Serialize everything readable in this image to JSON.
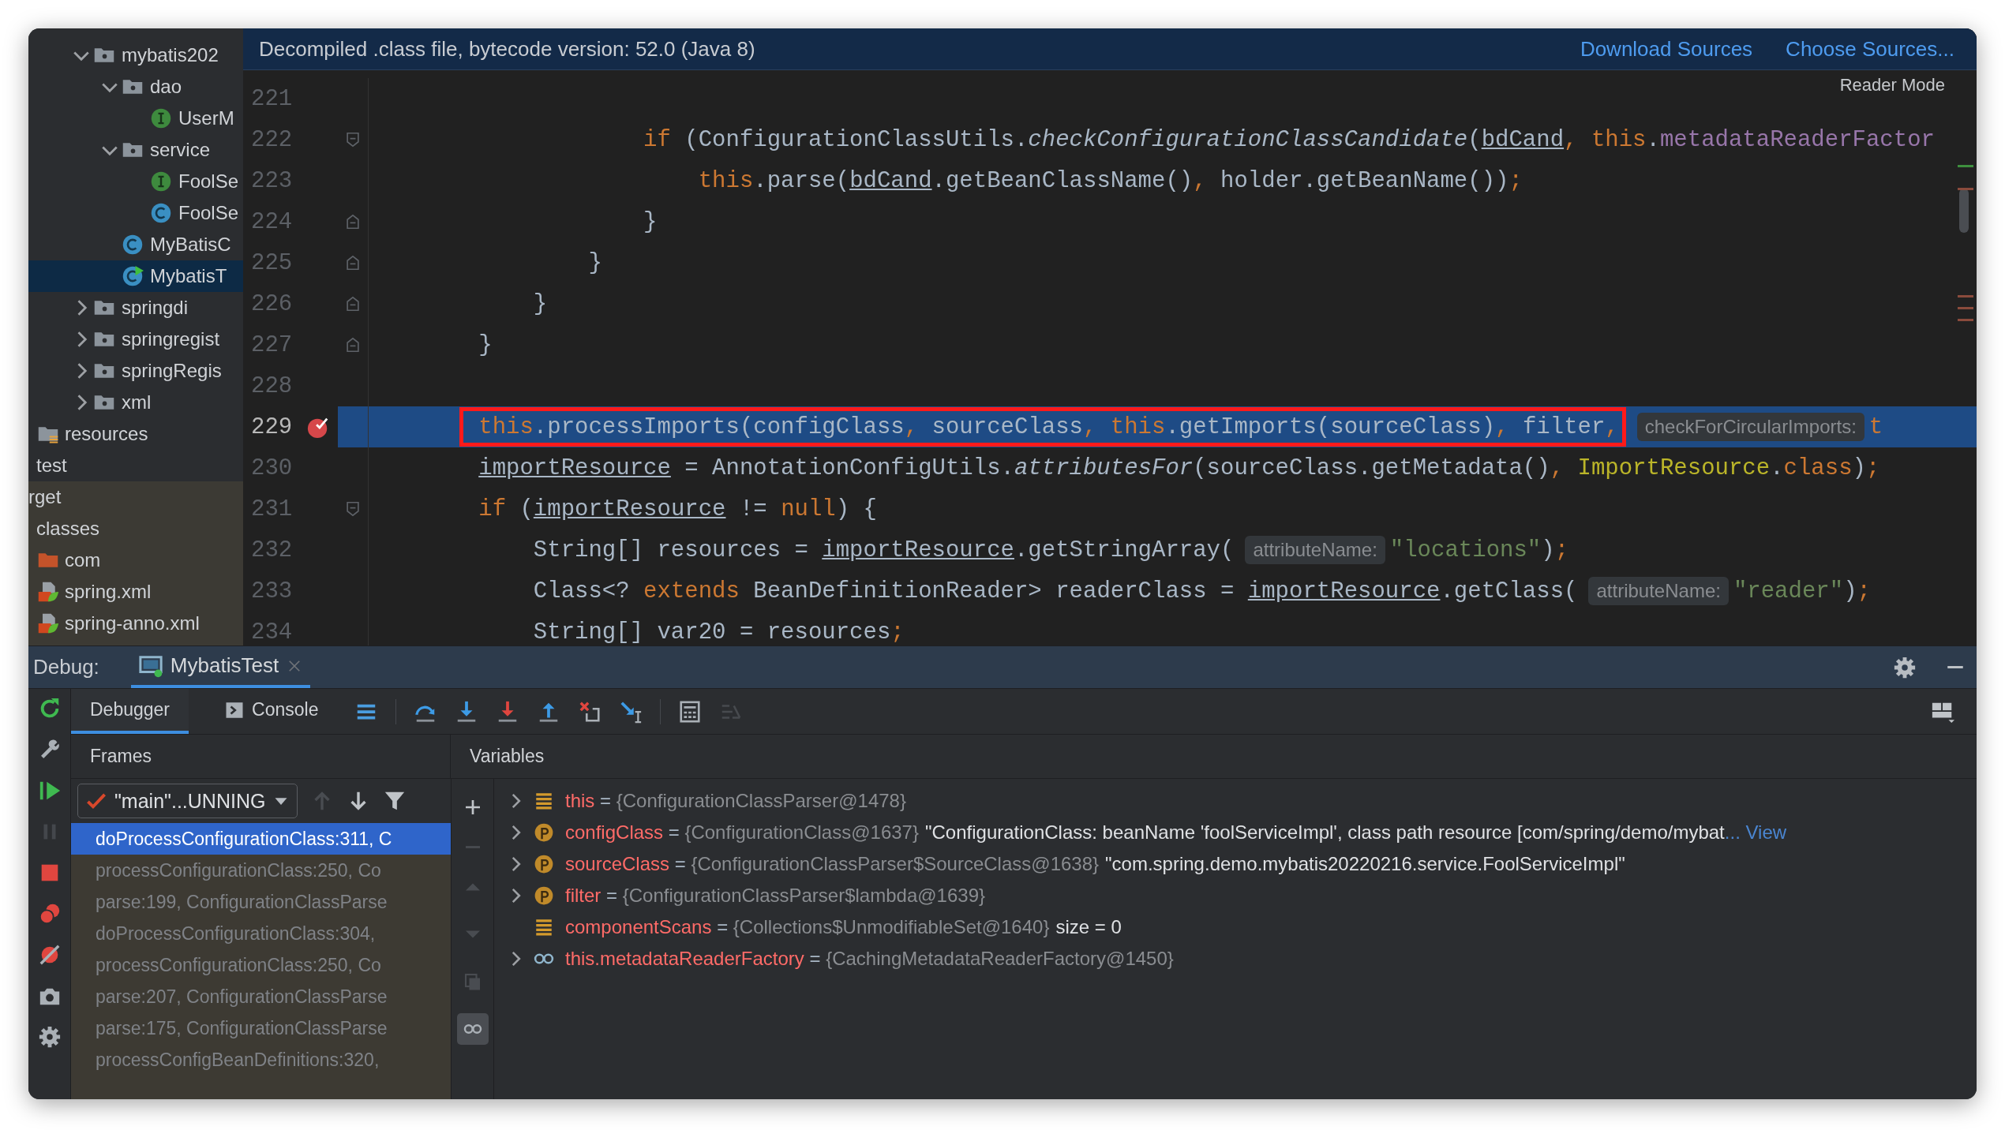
{
  "tree": {
    "groups": [
      {
        "excluded": false,
        "items": [
          {
            "label": "mybatis202",
            "kind": "package",
            "expanded": true,
            "selected": false,
            "children": [
              {
                "label": "dao",
                "kind": "package",
                "expanded": true,
                "selected": false,
                "children": [
                  {
                    "label": "UserM",
                    "kind": "interface",
                    "selected": false
                  }
                ]
              },
              {
                "label": "service",
                "kind": "package",
                "expanded": true,
                "selected": false,
                "children": [
                  {
                    "label": "FoolSe",
                    "kind": "interface",
                    "selected": false
                  },
                  {
                    "label": "FoolSe",
                    "kind": "class",
                    "selected": false
                  }
                ]
              },
              {
                "label": "MyBatisC",
                "kind": "class",
                "selected": false
              },
              {
                "label": "MybatisT",
                "kind": "class-main",
                "selected": true
              }
            ]
          },
          {
            "label": "springdi",
            "kind": "package",
            "expanded": false,
            "selected": false
          },
          {
            "label": "springregist",
            "kind": "package",
            "expanded": false,
            "selected": false
          },
          {
            "label": "springRegis",
            "kind": "package",
            "expanded": false,
            "selected": false
          },
          {
            "label": "xml",
            "kind": "package",
            "expanded": false,
            "selected": false
          }
        ]
      },
      {
        "excluded": false,
        "items": [
          {
            "label": "resources",
            "kind": "resources",
            "selected": false
          }
        ]
      },
      {
        "excluded": false,
        "items": [
          {
            "label": "test",
            "selected": false
          }
        ]
      },
      {
        "excluded": true,
        "items": [
          {
            "label": "rget",
            "selected": false,
            "children": [
              {
                "label": "classes",
                "selected": false,
                "children": [
                  {
                    "label": "com",
                    "kind": "excluded-folder",
                    "selected": false
                  },
                  {
                    "label": "spring.xml",
                    "kind": "spring-xml",
                    "selected": false
                  },
                  {
                    "label": "spring-anno.xml",
                    "kind": "spring-xml",
                    "selected": false
                  }
                ]
              }
            ]
          }
        ]
      }
    ]
  },
  "editor": {
    "banner": {
      "text": "Decompiled .class file, bytecode version: 52.0 (Java 8)",
      "links": [
        "Download Sources",
        "Choose Sources..."
      ]
    },
    "reader_mode": "Reader Mode",
    "lines": [
      {
        "n": "221",
        "current": false,
        "breakpoint": false
      },
      {
        "n": "222",
        "current": false,
        "breakpoint": false,
        "gutter": {
          "kind": "fold-start"
        },
        "tokens": [
          {
            "kind": "keyword",
            "text": "                    if"
          },
          {
            "kind": "plain",
            "text": " (ConfigurationClassUtils."
          },
          {
            "kind": "italic",
            "text": "checkConfigurationClassCandidate"
          },
          {
            "kind": "plain",
            "text": "("
          },
          {
            "kind": "underline",
            "text": "bdCand"
          },
          {
            "kind": "punct",
            "text": ", "
          },
          {
            "kind": "keyword",
            "text": "this"
          },
          {
            "kind": "plain",
            "text": "."
          },
          {
            "kind": "field",
            "text": "metadataReaderFactor"
          }
        ]
      },
      {
        "n": "223",
        "current": false,
        "breakpoint": false,
        "tokens": [
          {
            "kind": "keyword",
            "text": "                        this"
          },
          {
            "kind": "plain",
            "text": ".parse("
          },
          {
            "kind": "underline",
            "text": "bdCand"
          },
          {
            "kind": "plain",
            "text": ".getBeanClassName()"
          },
          {
            "kind": "punct",
            "text": ", "
          },
          {
            "kind": "plain",
            "text": "holder.getBeanName())"
          },
          {
            "kind": "punct",
            "text": ";"
          }
        ]
      },
      {
        "n": "224",
        "current": false,
        "breakpoint": false,
        "gutter": {
          "kind": "fold-end"
        },
        "tokens": [
          {
            "kind": "plain",
            "text": "                    }"
          }
        ]
      },
      {
        "n": "225",
        "current": false,
        "breakpoint": false,
        "gutter": {
          "kind": "fold-end"
        },
        "tokens": [
          {
            "kind": "plain",
            "text": "                }"
          }
        ]
      },
      {
        "n": "226",
        "current": false,
        "breakpoint": false,
        "gutter": {
          "kind": "fold-end"
        },
        "tokens": [
          {
            "kind": "plain",
            "text": "            }"
          }
        ]
      },
      {
        "n": "227",
        "current": false,
        "breakpoint": false,
        "gutter": {
          "kind": "fold-end"
        },
        "tokens": [
          {
            "kind": "plain",
            "text": "        }"
          }
        ]
      },
      {
        "n": "228",
        "current": false,
        "breakpoint": false
      },
      {
        "n": "229",
        "current": true,
        "breakpoint": true,
        "tokens": [
          {
            "kind": "box",
            "tokens": [
              {
                "kind": "keyword",
                "text": "this"
              },
              {
                "kind": "plain",
                "text": ".processImports(configClass"
              },
              {
                "kind": "punct",
                "text": ", "
              },
              {
                "kind": "plain",
                "text": "sourceClass"
              },
              {
                "kind": "punct",
                "text": ", "
              },
              {
                "kind": "keyword",
                "text": "this"
              },
              {
                "kind": "plain",
                "text": ".getImports(sourceClass)"
              },
              {
                "kind": "punct",
                "text": ", "
              },
              {
                "kind": "plain",
                "text": "filter"
              },
              {
                "kind": "punct",
                "text": ","
              }
            ]
          },
          {
            "kind": "hint",
            "text": "checkForCircularImports:"
          },
          {
            "kind": "keyword",
            "text": "t"
          }
        ]
      },
      {
        "n": "230",
        "current": false,
        "breakpoint": false,
        "tokens": [
          {
            "kind": "underline",
            "text": "        importResource"
          },
          {
            "kind": "plain",
            "text": " = AnnotationConfigUtils."
          },
          {
            "kind": "italic",
            "text": "attributesFor"
          },
          {
            "kind": "plain",
            "text": "(sourceClass.getMetadata()"
          },
          {
            "kind": "punct",
            "text": ", "
          },
          {
            "kind": "class",
            "text": "ImportResource"
          },
          {
            "kind": "plain",
            "text": "."
          },
          {
            "kind": "keyword",
            "text": "class"
          },
          {
            "kind": "plain",
            "text": ")"
          },
          {
            "kind": "punct",
            "text": ";"
          }
        ]
      },
      {
        "n": "231",
        "current": false,
        "breakpoint": false,
        "gutter": {
          "kind": "fold-start"
        },
        "tokens": [
          {
            "kind": "keyword",
            "text": "        if"
          },
          {
            "kind": "plain",
            "text": " ("
          },
          {
            "kind": "underline",
            "text": "importResource"
          },
          {
            "kind": "plain",
            "text": " != "
          },
          {
            "kind": "keyword",
            "text": "null"
          },
          {
            "kind": "plain",
            "text": ") {"
          }
        ]
      },
      {
        "n": "232",
        "current": false,
        "breakpoint": false,
        "tokens": [
          {
            "kind": "plain",
            "text": "            String[] resources = "
          },
          {
            "kind": "underline",
            "text": "importResource"
          },
          {
            "kind": "plain",
            "text": ".getStringArray("
          },
          {
            "kind": "hint",
            "text": "attributeName:"
          },
          {
            "kind": "string",
            "text": "\"locations\""
          },
          {
            "kind": "plain",
            "text": ")"
          },
          {
            "kind": "punct",
            "text": ";"
          }
        ]
      },
      {
        "n": "233",
        "current": false,
        "breakpoint": false,
        "tokens": [
          {
            "kind": "plain",
            "text": "            Class<? "
          },
          {
            "kind": "keyword",
            "text": "extends"
          },
          {
            "kind": "plain",
            "text": " BeanDefinitionReader> readerClass = "
          },
          {
            "kind": "underline",
            "text": "importResource"
          },
          {
            "kind": "plain",
            "text": ".getClass("
          },
          {
            "kind": "hint",
            "text": "attributeName:"
          },
          {
            "kind": "string",
            "text": "\"reader\""
          },
          {
            "kind": "plain",
            "text": ")"
          },
          {
            "kind": "punct",
            "text": ";"
          }
        ]
      },
      {
        "n": "234",
        "current": false,
        "breakpoint": false,
        "tokens": [
          {
            "kind": "plain",
            "text": "            String[] var20 = resources"
          },
          {
            "kind": "punct",
            "text": ";"
          }
        ]
      }
    ]
  },
  "debug": {
    "label": "Debug:",
    "tabs": [
      {
        "label": "MybatisTest",
        "selected": true
      }
    ],
    "subtabs": [
      {
        "label": "Debugger",
        "kind": "debugger",
        "selected": true
      },
      {
        "label": "Console",
        "kind": "console",
        "selected": false
      }
    ],
    "toolbar": [
      {
        "kind": "threads",
        "disabled": false
      },
      {
        "kind": "step-over",
        "disabled": false
      },
      {
        "kind": "step-into",
        "disabled": false
      },
      {
        "kind": "force-step-into",
        "disabled": false
      },
      {
        "kind": "step-out",
        "disabled": false
      },
      {
        "kind": "drop-frame",
        "disabled": false
      },
      {
        "kind": "run-to-cursor",
        "disabled": false
      },
      {
        "kind": "evaluate",
        "disabled": false
      },
      {
        "kind": "trace",
        "disabled": true
      }
    ],
    "side_tools": [
      {
        "kind": "rerun",
        "disabled": false
      },
      {
        "kind": "modify",
        "disabled": false
      },
      {
        "kind": "resume",
        "disabled": false
      },
      {
        "kind": "pause",
        "disabled": true
      },
      {
        "kind": "stop",
        "disabled": false
      },
      {
        "kind": "breakpoints",
        "disabled": false
      },
      {
        "kind": "mute",
        "disabled": false
      },
      {
        "kind": "camera",
        "disabled": false
      },
      {
        "kind": "settings",
        "disabled": false
      }
    ],
    "frames": {
      "title": "Frames",
      "thread": "\"main\"...UNNING",
      "nav": [
        {
          "kind": "up",
          "disabled": true
        },
        {
          "kind": "down",
          "disabled": false
        },
        {
          "kind": "filter",
          "disabled": false
        }
      ],
      "items": [
        {
          "text": "doProcessConfigurationClass:311, C",
          "selected": true,
          "library": false
        },
        {
          "text": "processConfigurationClass:250, Co",
          "selected": false,
          "library": true
        },
        {
          "text": "parse:199, ConfigurationClassParse",
          "selected": false,
          "library": true
        },
        {
          "text": "doProcessConfigurationClass:304,",
          "selected": false,
          "library": true
        },
        {
          "text": "processConfigurationClass:250, Co",
          "selected": false,
          "library": true
        },
        {
          "text": "parse:207, ConfigurationClassParse",
          "selected": false,
          "library": true
        },
        {
          "text": "parse:175, ConfigurationClassParse",
          "selected": false,
          "library": true
        },
        {
          "text": "processConfigBeanDefinitions:320,",
          "selected": false,
          "library": true
        }
      ]
    },
    "variables": {
      "title": "Variables",
      "tools": [
        {
          "kind": "add",
          "disabled": false,
          "selected": false
        },
        {
          "kind": "remove",
          "disabled": true,
          "selected": false
        },
        {
          "kind": "move-up",
          "disabled": true,
          "selected": false
        },
        {
          "kind": "move-down",
          "disabled": true,
          "selected": false
        },
        {
          "kind": "copy",
          "disabled": true,
          "selected": false
        },
        {
          "kind": "watches",
          "disabled": false,
          "selected": true
        }
      ],
      "items": [
        {
          "kind": "field",
          "expandable": true,
          "name": "this",
          "operator": "=",
          "value": "{ConfigurationClassParser@1478}"
        },
        {
          "kind": "param",
          "expandable": true,
          "name": "configClass",
          "operator": "=",
          "value": "{ConfigurationClass@1637}",
          "extra": "\"ConfigurationClass: beanName 'foolServiceImpl', class path resource [com/spring/demo/mybat",
          "link": "... View"
        },
        {
          "kind": "param",
          "expandable": true,
          "name": "sourceClass",
          "operator": "=",
          "value": "{ConfigurationClassParser$SourceClass@1638}",
          "extra": "\"com.spring.demo.mybatis20220216.service.FoolServiceImpl\""
        },
        {
          "kind": "param",
          "expandable": true,
          "name": "filter",
          "operator": "=",
          "value": "{ConfigurationClassParser$lambda@1639}"
        },
        {
          "kind": "field",
          "expandable": false,
          "name": "componentScans",
          "operator": "=",
          "value": "{Collections$UnmodifiableSet@1640}",
          "extra": "size = 0"
        },
        {
          "kind": "watch",
          "expandable": true,
          "name": "this.metadataReaderFactory",
          "operator": "=",
          "value": "{CachingMetadataReaderFactory@1450}"
        }
      ]
    }
  }
}
